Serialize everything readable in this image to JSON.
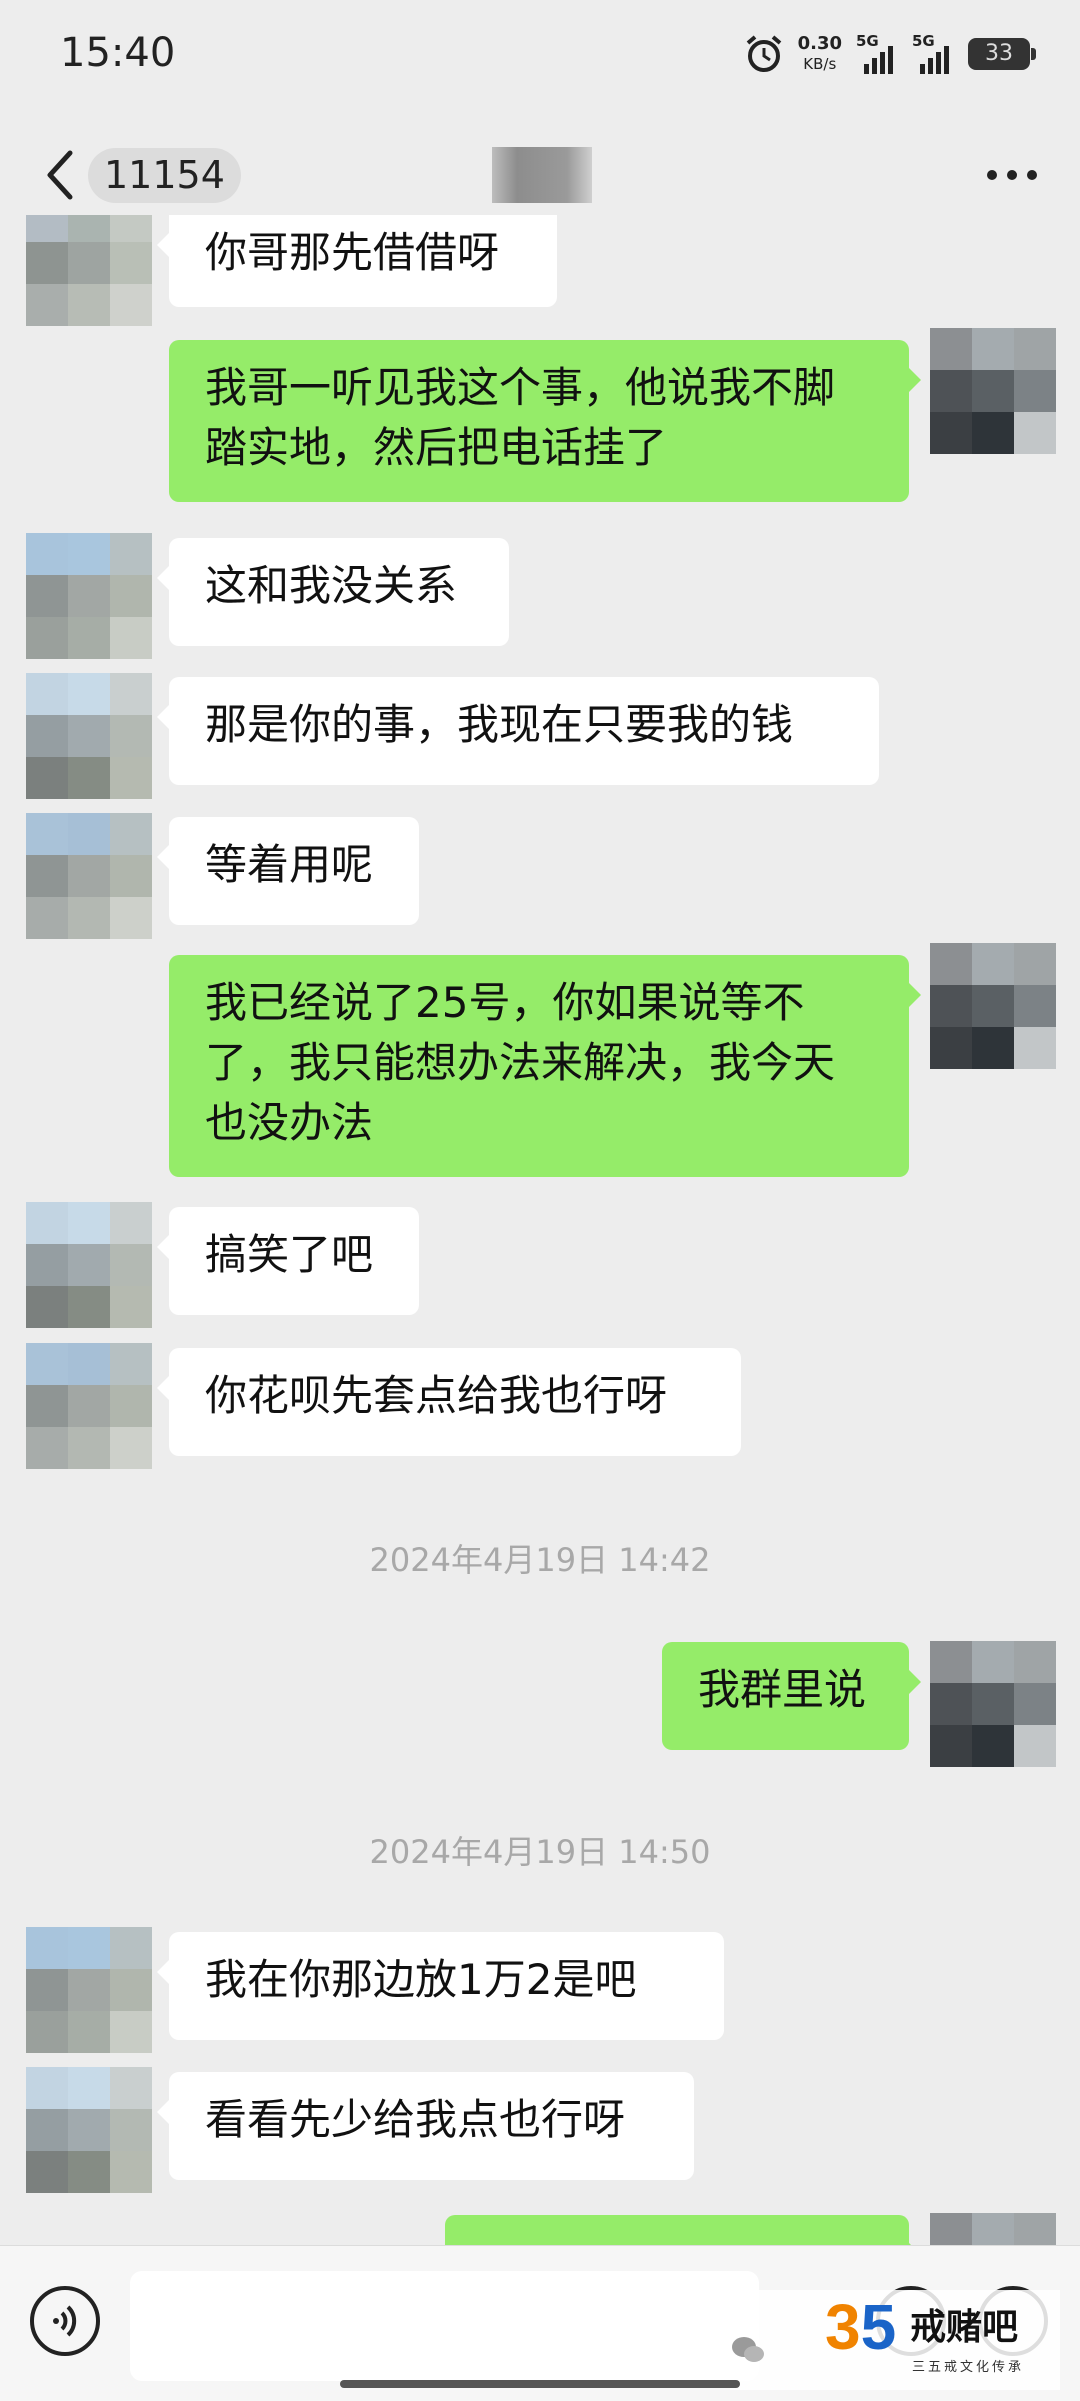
{
  "status_bar": {
    "time": "15:40",
    "net_speed_value": "0.30",
    "net_speed_unit": "KB/s",
    "sim1_label": "5G",
    "sim2_label": "5G",
    "battery": "33",
    "icons": [
      "alarm-icon",
      "signal-icon",
      "battery-icon"
    ]
  },
  "header": {
    "unread_count": "11154",
    "icons": [
      "chevron-left-icon",
      "more-icon"
    ]
  },
  "messages": [
    {
      "side": "in",
      "text": "你哥那先借借呀"
    },
    {
      "side": "out",
      "text": "我哥一听见我这个事，他说我不脚踏实地，然后把电话挂了"
    },
    {
      "side": "in",
      "text": "这和我没关系"
    },
    {
      "side": "in",
      "text": "那是你的事，我现在只要我的钱"
    },
    {
      "side": "in",
      "text": "等着用呢"
    },
    {
      "side": "out",
      "text": "我已经说了25号，你如果说等不了，我只能想办法来解决，我今天也没办法"
    },
    {
      "side": "in",
      "text": "搞笑了吧"
    },
    {
      "side": "in",
      "text": "你花呗先套点给我也行呀"
    },
    {
      "type": "time",
      "text": "2024年4月19日 14:42"
    },
    {
      "side": "out",
      "text": "我群里说"
    },
    {
      "type": "time",
      "text": "2024年4月19日 14:50"
    },
    {
      "side": "in",
      "text": "我在你那边放1万2是吧"
    },
    {
      "side": "in",
      "text": "看看先少给我点也行呀"
    }
  ],
  "input_bar": {
    "icons": [
      "voice-icon",
      "emoji-icon",
      "add-icon"
    ]
  },
  "watermark": {
    "number_digit_1": "3",
    "number_digit_2": "5",
    "brand": "戒赌吧",
    "subtitle": "三五戒文化传承",
    "icons": [
      "wechat-icon"
    ]
  },
  "colors": {
    "background": "#ededed",
    "incoming_bubble": "#ffffff",
    "outgoing_bubble": "#95ec69",
    "timestamp_text": "#a8a8a8"
  }
}
